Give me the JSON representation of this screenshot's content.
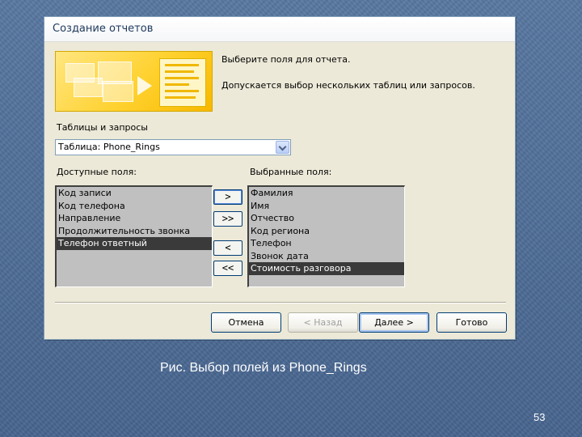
{
  "dialog": {
    "title": "Создание отчетов",
    "instruction": "Выберите поля для отчета.",
    "note": "Допускается выбор нескольких таблиц или запросов.",
    "tables_label": "Таблицы и запросы",
    "table_select_value": "Таблица: Phone_Rings",
    "available_label": "Доступные поля:",
    "selected_label": "Выбранные поля:",
    "available_fields": [
      "Код записи",
      "Код телефона",
      "Направление",
      "Продолжительность звонка",
      "Телефон ответный"
    ],
    "available_selected_index": 4,
    "selected_fields": [
      "Фамилия",
      "Имя",
      "Отчество",
      "Код региона",
      "Телефон",
      "Звонок дата",
      "Стоимость разговора"
    ],
    "selected_selected_index": 6,
    "move_buttons": {
      "add_one": ">",
      "add_all": ">>",
      "remove_one": "<",
      "remove_all": "<<"
    },
    "buttons": {
      "cancel": "Отмена",
      "back": "< Назад",
      "next": "Далее >",
      "finish": "Готово"
    }
  },
  "slide": {
    "caption": "Рис. Выбор полей из Phone_Rings",
    "page_number": "53"
  }
}
